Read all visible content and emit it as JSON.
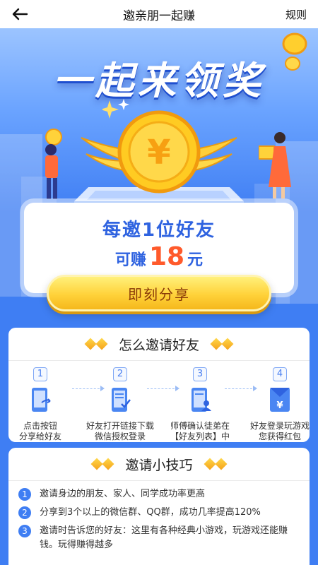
{
  "header": {
    "title": "邀亲朋一起赚",
    "rules": "规则"
  },
  "hero": {
    "title": "一起来领奖",
    "reward": {
      "prefix": "每邀1位好友",
      "earn": "可赚",
      "amount": "18",
      "unit": "元"
    },
    "share_button": "即刻分享"
  },
  "how": {
    "title": "怎么邀请好友",
    "steps": [
      {
        "num": "1",
        "text": "点击按钮\n分享给好友"
      },
      {
        "num": "2",
        "text": "好友打开链接下载\n微信授权登录"
      },
      {
        "num": "3",
        "text": "师傅确认徒弟在\n【好友列表】中"
      },
      {
        "num": "4",
        "text": "好友登录玩游戏\n您获得红包"
      }
    ]
  },
  "tips": {
    "title": "邀请小技巧",
    "items": [
      {
        "num": "1",
        "text": "邀请身边的朋友、家人、同学成功率更高"
      },
      {
        "num": "2",
        "text": "分享到3个以上的微信群、QQ群，成功几率提高120%"
      },
      {
        "num": "3",
        "text": "邀请时告诉您的好友：这里有各种经典小游戏，玩游戏还能赚钱。玩得赚得越多"
      }
    ]
  },
  "colors": {
    "primary": "#3f7ef3",
    "accent": "#ff5a2b",
    "button": "#ffd23a"
  }
}
